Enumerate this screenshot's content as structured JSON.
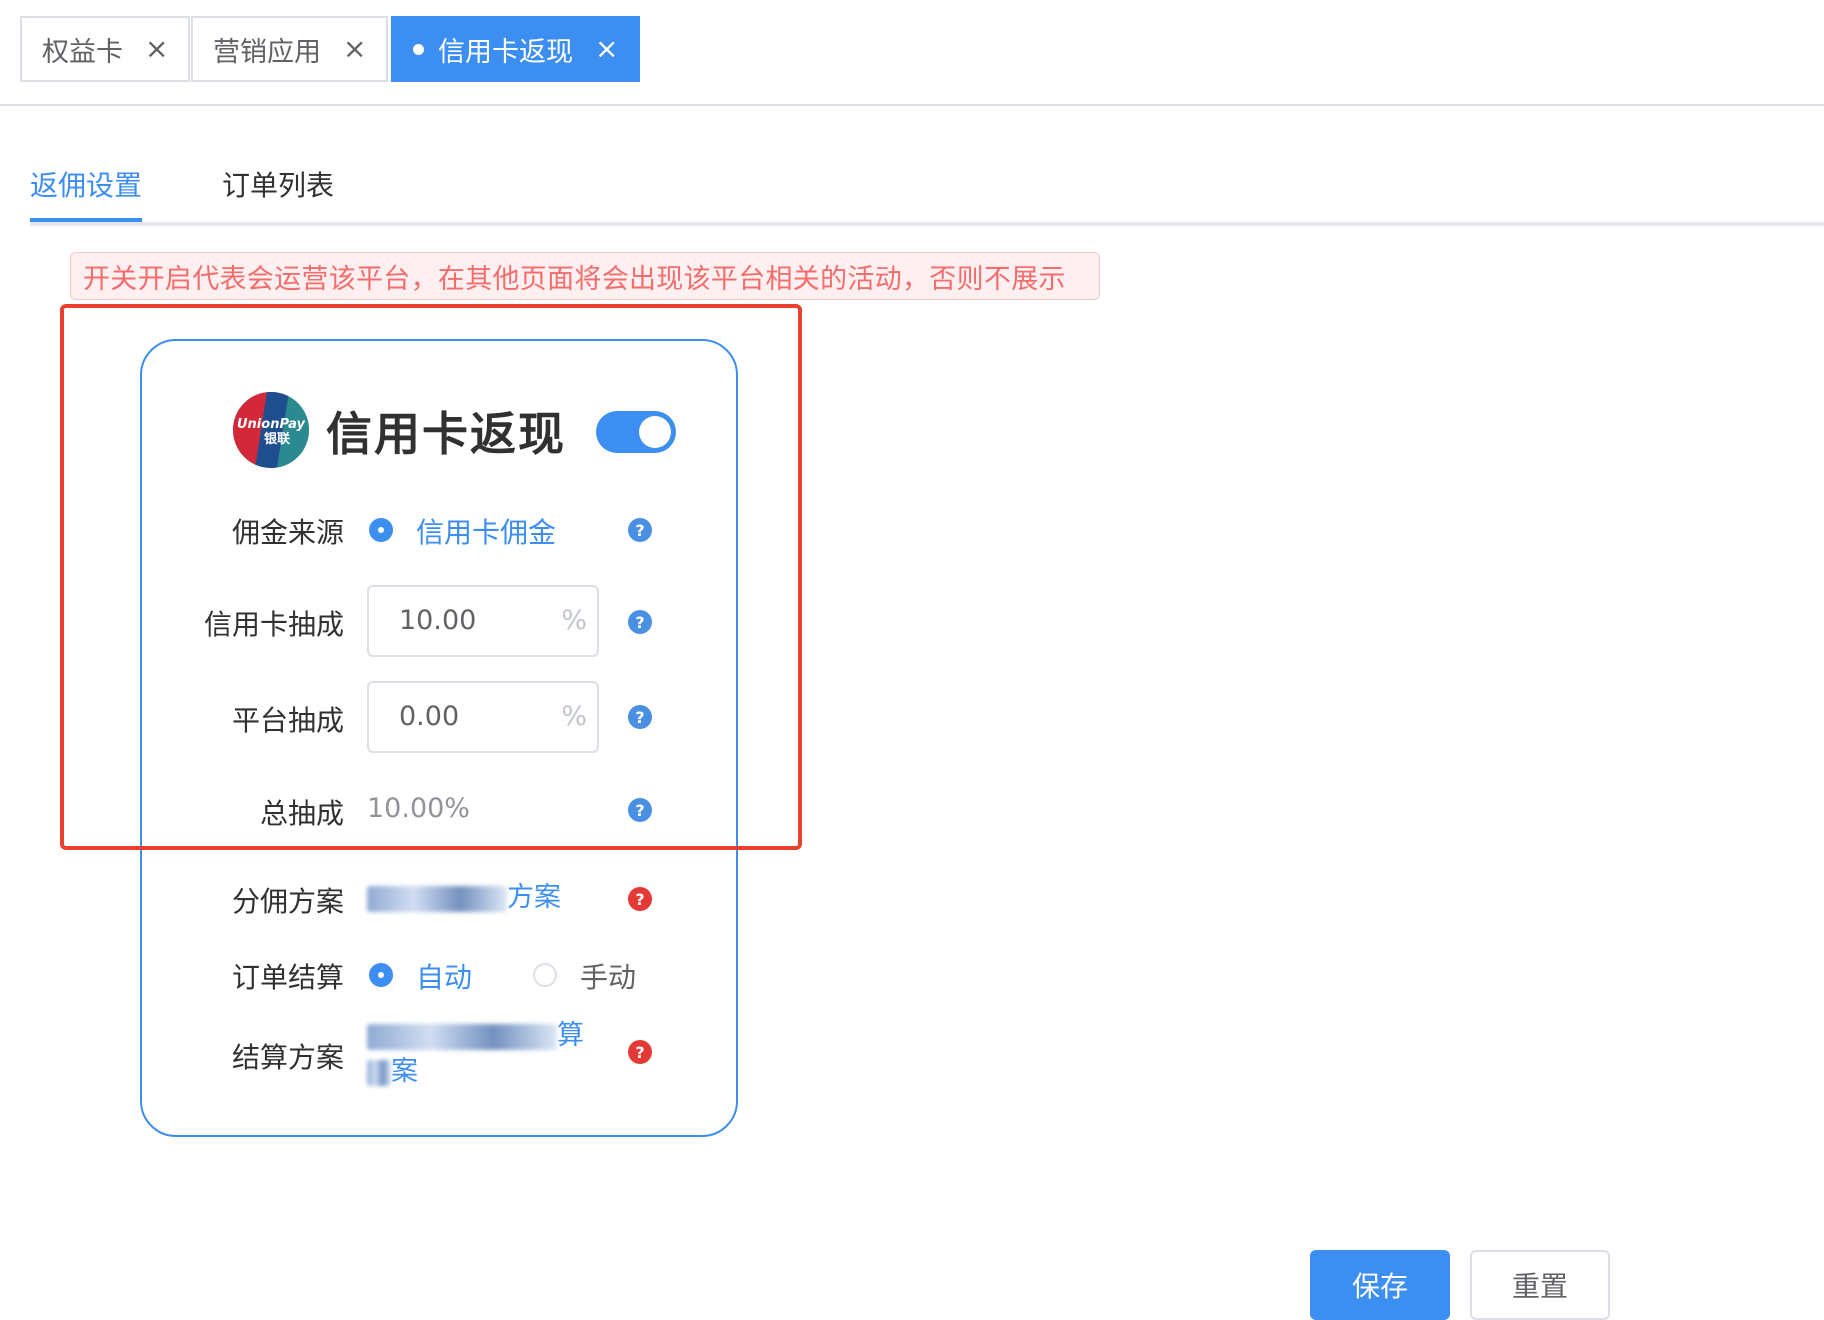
{
  "tabs_bar": {
    "tags": [
      {
        "label": "权益卡",
        "close": "×"
      },
      {
        "label": "营销应用",
        "close": "×"
      },
      {
        "label": "信用卡返现",
        "close": "×"
      }
    ]
  },
  "page_tabs": [
    "返佣设置",
    "订单列表"
  ],
  "alert": "开关开启代表会运营该平台，在其他页面将会出现该平台相关的活动，否则不展示",
  "card": {
    "logo_text_1": "UnionPay",
    "logo_text_2": "银联",
    "title": "信用卡返现",
    "enabled": true,
    "rows": {
      "commission_source": {
        "label": "佣金来源",
        "option": "信用卡佣金"
      },
      "card_commission": {
        "label": "信用卡抽成",
        "value": "10.00",
        "unit": "%"
      },
      "platform_commission": {
        "label": "平台抽成",
        "value": "0.00",
        "unit": "%"
      },
      "total_commission": {
        "label": "总抽成",
        "value": "10.00%"
      },
      "split_plan": {
        "label": "分佣方案",
        "value_suffix": "方案"
      },
      "settlement": {
        "label": "订单结算",
        "option_auto": "自动",
        "option_manual": "手动"
      },
      "settlement_plan": {
        "label": "结算方案",
        "value_suffix": "算",
        "value_line2_suffix": "案"
      }
    },
    "help_glyph": "?"
  },
  "buttons": {
    "save": "保存",
    "reset": "重置"
  },
  "colors": {
    "primary": "#3d8ef1",
    "danger": "#e8412e",
    "alert_text": "#f56c6c"
  }
}
